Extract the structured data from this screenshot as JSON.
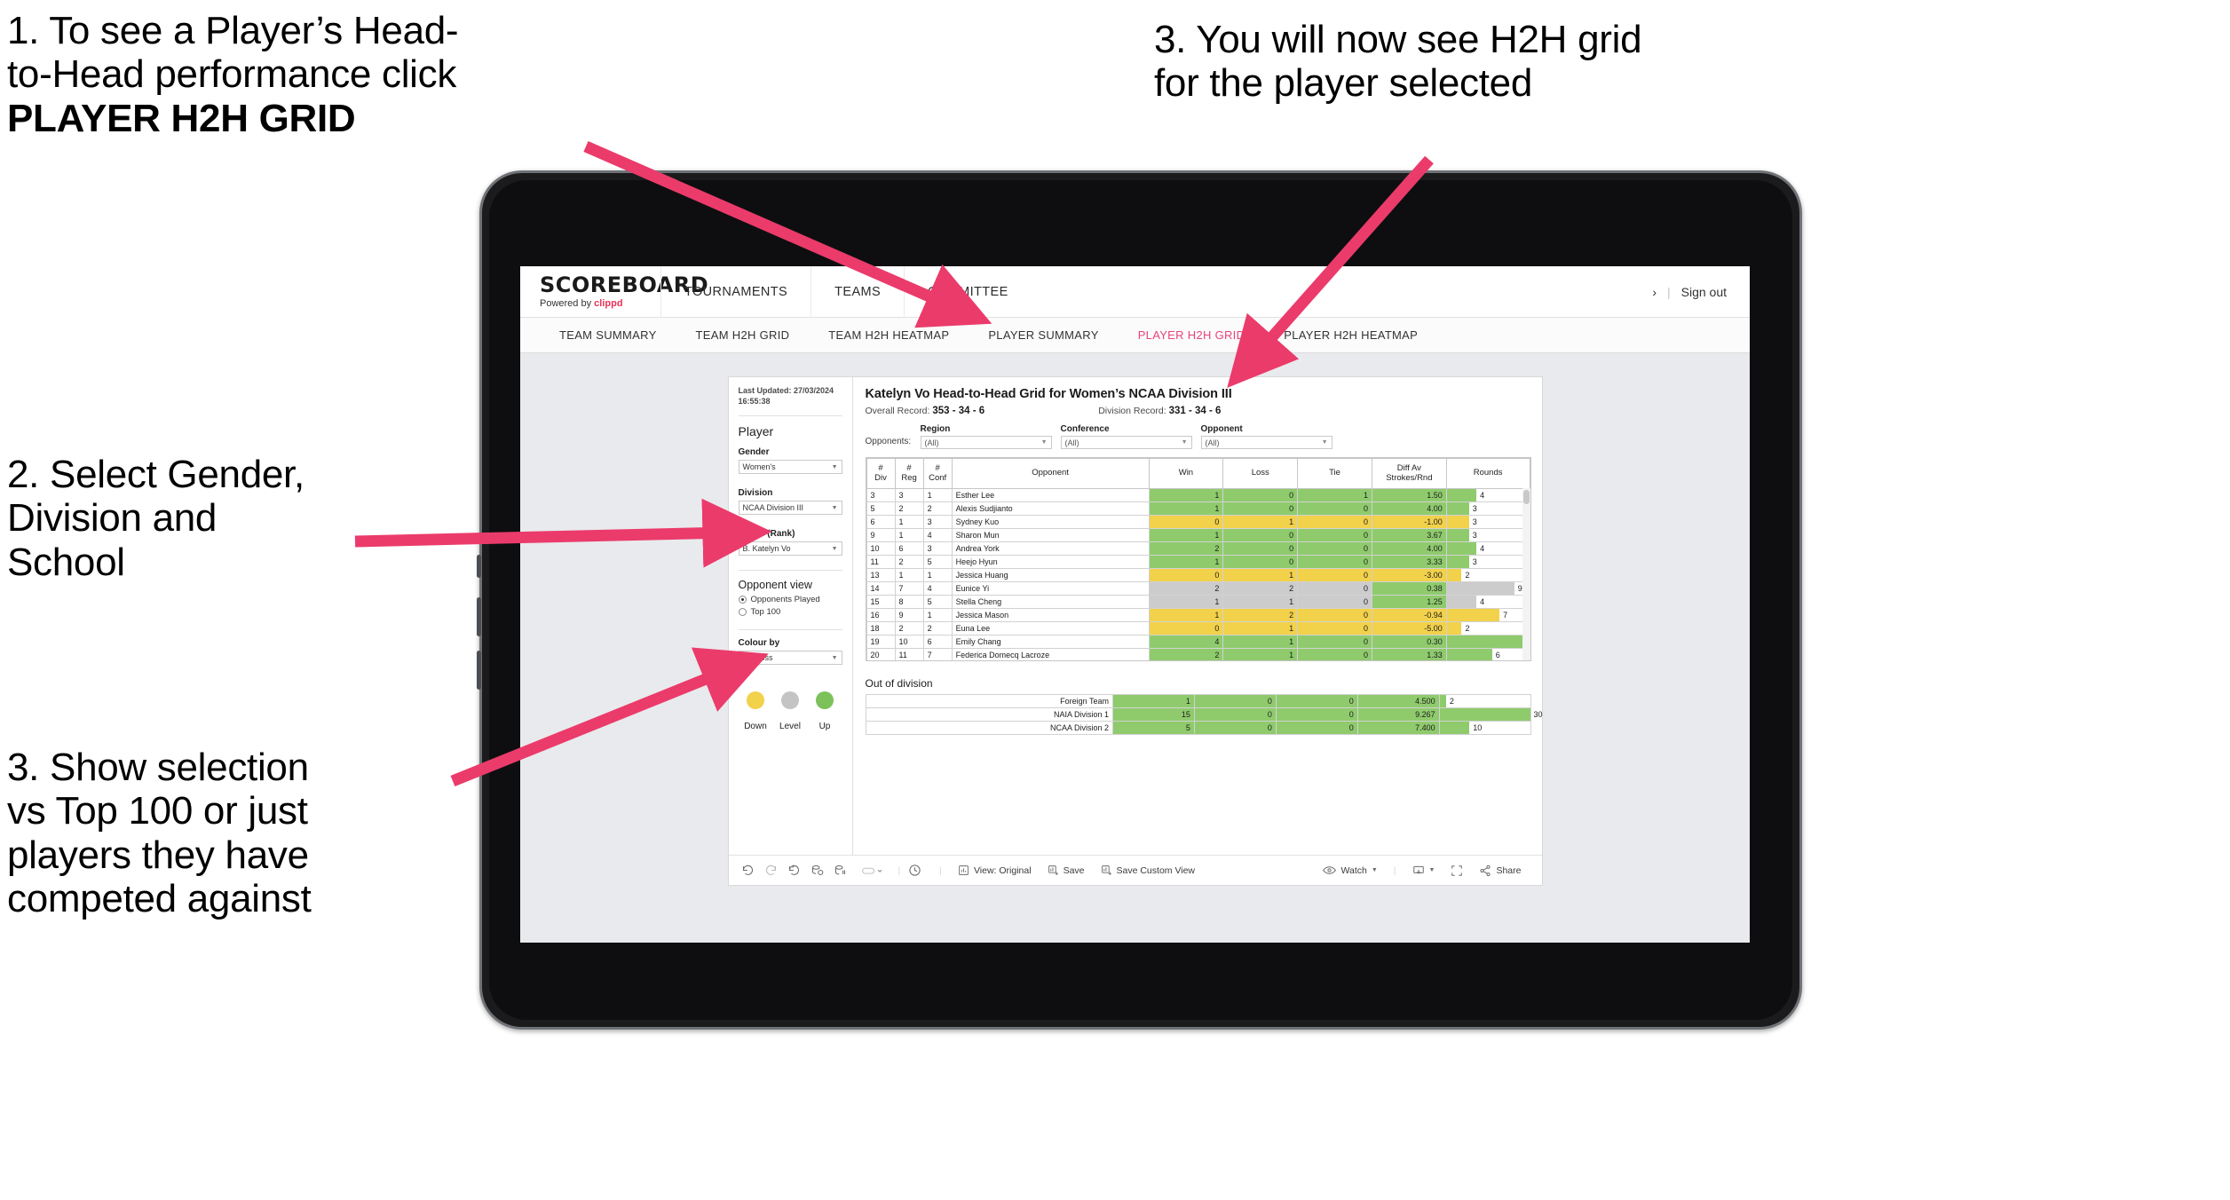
{
  "annotations": {
    "a1_line1": "1. To see a Player’s Head-",
    "a1_line2": "to-Head performance click",
    "a1_bold": "PLAYER H2H GRID",
    "a2_line1": "2. Select Gender,",
    "a2_line2": "Division and",
    "a2_line3": "School",
    "a3_line1": "3. Show selection",
    "a3_line2": "vs Top 100 or just",
    "a3_line3": "players they have",
    "a3_line4": "competed against",
    "a4_line1": "3. You will now see H2H grid",
    "a4_line2": "for the player selected",
    "arrow_color": "#eb3b6b"
  },
  "brand": {
    "logo": "SCOREBOARD",
    "powered_prefix": "Powered by ",
    "powered_brand": "clippd",
    "accent": "#e8345a"
  },
  "topnav": {
    "items": [
      "TOURNAMENTS",
      "TEAMS",
      "COMMITTEE"
    ],
    "account_chevron": "›",
    "divider": "|",
    "signout": "Sign out"
  },
  "subnav": {
    "items": [
      {
        "label": "TEAM SUMMARY",
        "active": false
      },
      {
        "label": "TEAM H2H GRID",
        "active": false
      },
      {
        "label": "TEAM H2H HEATMAP",
        "active": false
      },
      {
        "label": "PLAYER SUMMARY",
        "active": false
      },
      {
        "label": "PLAYER H2H GRID",
        "active": true
      },
      {
        "label": "PLAYER H2H HEATMAP",
        "active": false
      }
    ],
    "active_color": "#e8447a"
  },
  "filters": {
    "last_updated_line1": "Last Updated: 27/03/2024",
    "last_updated_line2": "16:55:38",
    "player_heading": "Player",
    "gender_label": "Gender",
    "gender_value": "Women's",
    "division_label": "Division",
    "division_value": "NCAA Division III",
    "player_label": "Player (Rank)",
    "player_value": "B. Katelyn Vo",
    "opponent_view_heading": "Opponent view",
    "radio_opponents_played": "Opponents Played",
    "radio_top100": "Top 100",
    "radio_selected": "Opponents Played",
    "colour_by_label": "Colour by",
    "colour_by_value": "Win/loss",
    "legend": [
      {
        "label": "Down",
        "color": "#f2d14b"
      },
      {
        "label": "Level",
        "color": "#c4c4c4"
      },
      {
        "label": "Up",
        "color": "#7cc159"
      }
    ]
  },
  "viz": {
    "title": "Katelyn Vo Head-to-Head Grid for Women’s NCAA Division III",
    "overall_record_label": "Overall Record:",
    "overall_record_value": "353 -  34 - 6",
    "division_record_label": "Division Record:",
    "division_record_value": "331 -  34 - 6",
    "opponents_label": "Opponents:",
    "opponent_filters": [
      {
        "caption": "Region",
        "value": "(All)"
      },
      {
        "caption": "Conference",
        "value": "(All)"
      },
      {
        "caption": "Opponent",
        "value": "(All)"
      }
    ],
    "out_of_division_title": "Out of division"
  },
  "chart_data": {
    "type": "table",
    "title": "Katelyn Vo Head-to-Head Grid for Women’s NCAA Division III",
    "columns": [
      "# Div",
      "# Reg",
      "# Conf",
      "Opponent",
      "Win",
      "Loss",
      "Tie",
      "Diff Av Strokes/Rnd",
      "Rounds"
    ],
    "column_headers_multiline": [
      [
        "#",
        "Div"
      ],
      [
        "#",
        "Reg"
      ],
      [
        "#",
        "Conf"
      ],
      [
        "Opponent"
      ],
      [
        "Win"
      ],
      [
        "Loss"
      ],
      [
        "Tie"
      ],
      [
        "Diff Av",
        "Strokes/Rnd"
      ],
      [
        "Rounds"
      ]
    ],
    "rounds_max": 11,
    "rows": [
      {
        "div": "3",
        "reg": "3",
        "conf": "1",
        "opponent": "Esther Lee",
        "win": "1",
        "loss": "0",
        "tie": "1",
        "diff": "1.50",
        "rounds": "4",
        "state": "up"
      },
      {
        "div": "5",
        "reg": "2",
        "conf": "2",
        "opponent": "Alexis Sudjianto",
        "win": "1",
        "loss": "0",
        "tie": "0",
        "diff": "4.00",
        "rounds": "3",
        "state": "up"
      },
      {
        "div": "6",
        "reg": "1",
        "conf": "3",
        "opponent": "Sydney Kuo",
        "win": "0",
        "loss": "1",
        "tie": "0",
        "diff": "-1.00",
        "rounds": "3",
        "state": "down"
      },
      {
        "div": "9",
        "reg": "1",
        "conf": "4",
        "opponent": "Sharon Mun",
        "win": "1",
        "loss": "0",
        "tie": "0",
        "diff": "3.67",
        "rounds": "3",
        "state": "up"
      },
      {
        "div": "10",
        "reg": "6",
        "conf": "3",
        "opponent": "Andrea York",
        "win": "2",
        "loss": "0",
        "tie": "0",
        "diff": "4.00",
        "rounds": "4",
        "state": "up"
      },
      {
        "div": "11",
        "reg": "2",
        "conf": "5",
        "opponent": "Heejo Hyun",
        "win": "1",
        "loss": "0",
        "tie": "0",
        "diff": "3.33",
        "rounds": "3",
        "state": "up"
      },
      {
        "div": "13",
        "reg": "1",
        "conf": "1",
        "opponent": "Jessica Huang",
        "win": "0",
        "loss": "1",
        "tie": "0",
        "diff": "-3.00",
        "rounds": "2",
        "state": "down"
      },
      {
        "div": "14",
        "reg": "7",
        "conf": "4",
        "opponent": "Eunice Yi",
        "win": "2",
        "loss": "2",
        "tie": "0",
        "diff": "0.38",
        "rounds": "9",
        "state": "level"
      },
      {
        "div": "15",
        "reg": "8",
        "conf": "5",
        "opponent": "Stella Cheng",
        "win": "1",
        "loss": "1",
        "tie": "0",
        "diff": "1.25",
        "rounds": "4",
        "state": "level"
      },
      {
        "div": "16",
        "reg": "9",
        "conf": "1",
        "opponent": "Jessica Mason",
        "win": "1",
        "loss": "2",
        "tie": "0",
        "diff": "-0.94",
        "rounds": "7",
        "state": "down"
      },
      {
        "div": "18",
        "reg": "2",
        "conf": "2",
        "opponent": "Euna Lee",
        "win": "0",
        "loss": "1",
        "tie": "0",
        "diff": "-5.00",
        "rounds": "2",
        "state": "down"
      },
      {
        "div": "19",
        "reg": "10",
        "conf": "6",
        "opponent": "Emily Chang",
        "win": "4",
        "loss": "1",
        "tie": "0",
        "diff": "0.30",
        "rounds": "11",
        "state": "up"
      },
      {
        "div": "20",
        "reg": "11",
        "conf": "7",
        "opponent": "Federica Domecq Lacroze",
        "win": "2",
        "loss": "1",
        "tie": "0",
        "diff": "1.33",
        "rounds": "6",
        "state": "up"
      }
    ],
    "out_of_division": {
      "rounds_max": 30,
      "rows": [
        {
          "name": "Foreign Team",
          "win": "1",
          "loss": "0",
          "tie": "0",
          "diff": "4.500",
          "rounds": "2",
          "state": "up"
        },
        {
          "name": "NAIA Division 1",
          "win": "15",
          "loss": "0",
          "tie": "0",
          "diff": "9.267",
          "rounds": "30",
          "state": "up"
        },
        {
          "name": "NCAA Division 2",
          "win": "5",
          "loss": "0",
          "tie": "0",
          "diff": "7.400",
          "rounds": "10",
          "state": "up"
        }
      ]
    }
  },
  "toolbar": {
    "undo_icon": "undo-icon",
    "redo_icon": "redo-icon",
    "revert_icon": "revert-icon",
    "refresh_icon": "refresh-data-icon",
    "pause_icon": "pause-updates-icon",
    "view_dropdown_icon": "view-dropdown-icon",
    "history_icon": "history-icon",
    "view_original": "View: Original",
    "save": "Save",
    "save_custom_view": "Save Custom View",
    "watch": "Watch",
    "device_icon": "device-layout-icon",
    "fullscreen_icon": "fullscreen-icon",
    "share": "Share"
  }
}
